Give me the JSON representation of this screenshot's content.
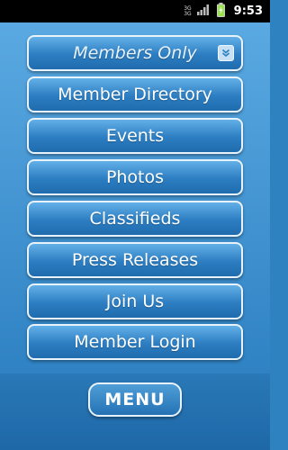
{
  "status_bar": {
    "network_top": "3G",
    "network_bottom": "3G",
    "time": "9:53"
  },
  "menu": {
    "dropdown_label": "Members Only",
    "items": [
      "Member Directory",
      "Events",
      "Photos",
      "Classifieds",
      "Press Releases",
      "Join Us",
      "Member Login"
    ]
  },
  "bottom_bar": {
    "menu_label": "MENU"
  }
}
